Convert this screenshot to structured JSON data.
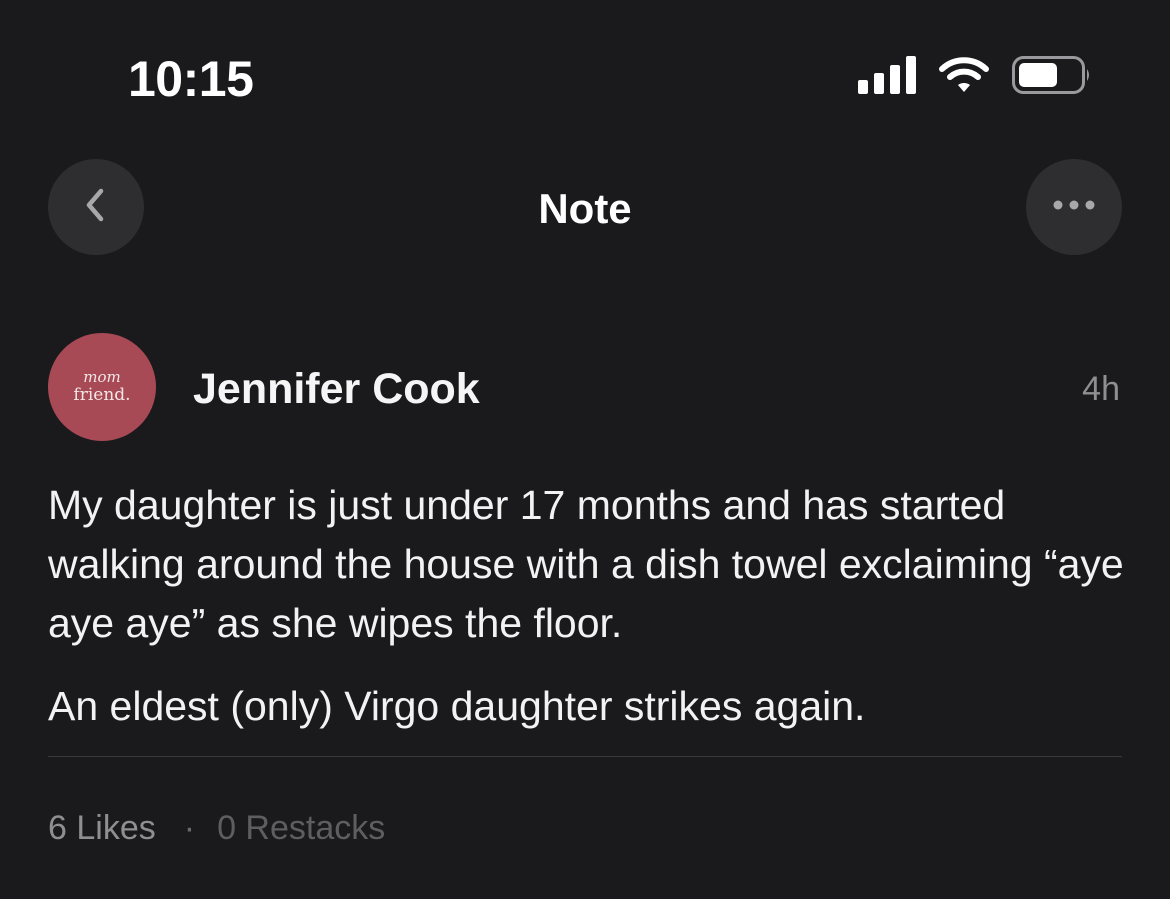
{
  "status_bar": {
    "time": "10:15",
    "icons": [
      "cellular-signal-icon",
      "wifi-icon",
      "battery-icon"
    ]
  },
  "nav": {
    "title": "Note",
    "back_icon": "chevron-left-icon",
    "more_icon": "ellipsis-icon"
  },
  "author": {
    "name": "Jennifer Cook",
    "timestamp": "4h",
    "avatar": {
      "line1": "mom",
      "line2": "friend.",
      "color": "#a84a55"
    }
  },
  "note": {
    "paragraphs": [
      "My daughter is just under 17 months and has started walking around the house with a dish towel exclaiming “aye aye aye” as she wipes the floor.",
      "An eldest (only) Virgo daughter strikes again."
    ]
  },
  "stats": {
    "likes": "6 Likes",
    "separator": "·",
    "restacks": "0 Restacks"
  },
  "colors": {
    "background": "#1a1a1c",
    "button_bg": "#2e2e30",
    "muted_text": "#8e8e93"
  }
}
